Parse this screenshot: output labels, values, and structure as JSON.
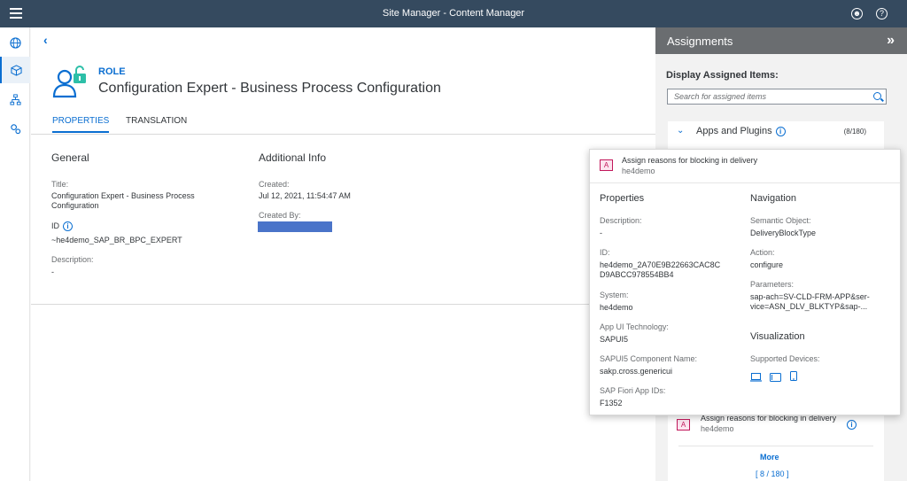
{
  "shell": {
    "title": "Site Manager - Content Manager"
  },
  "role": {
    "label": "ROLE",
    "title": "Configuration Expert - Business Process Configuration",
    "tabs": [
      "PROPERTIES",
      "TRANSLATION"
    ]
  },
  "general": {
    "heading": "General",
    "title_label": "Title:",
    "title_value": "Configuration Expert - Business Process Configuration",
    "id_label": "ID",
    "id_value": "~he4demo_SAP_BR_BPC_EXPERT",
    "description_label": "Description:",
    "description_value": "-"
  },
  "additional": {
    "heading": "Additional Info",
    "created_label": "Created:",
    "created_value": "Jul 12, 2021, 11:54:47 AM",
    "created_by_label": "Created By:"
  },
  "assignments": {
    "title": "Assignments",
    "display_label": "Display Assigned Items:",
    "search_placeholder": "Search for assigned items",
    "group_label": "Apps and Plugins",
    "group_count": "(8/180)",
    "item_title": "Assign reasons for blocking in delivery",
    "item_subtitle": "he4demo",
    "more": "More",
    "pager": "[ 8 / 180 ]"
  },
  "popover": {
    "title": "Assign reasons for blocking in delivery",
    "subtitle": "he4demo",
    "properties_heading": "Properties",
    "description_label": "Description:",
    "description_value": "-",
    "id_label": "ID:",
    "id_value": "he4demo_2A70E9B22663CAC8C\nD9ABCC978554BB4",
    "system_label": "System:",
    "system_value": "he4demo",
    "tech_label": "App UI Technology:",
    "tech_value": "SAPUI5",
    "component_label": "SAPUI5 Component Name:",
    "component_value": "sakp.cross.genericui",
    "fiori_label": "SAP Fiori App IDs:",
    "fiori_value": "F1352",
    "navigation_heading": "Navigation",
    "semantic_label": "Semantic Object:",
    "semantic_value": "DeliveryBlockType",
    "action_label": "Action:",
    "action_value": "configure",
    "parameters_label": "Parameters:",
    "parameters_value": "sap-ach=SV-CLD-FRM-APP&ser-\nvice=ASN_DLV_BLKTYP&sap-...",
    "visualization_heading": "Visualization",
    "devices_label": "Supported Devices:"
  },
  "colors": {
    "shell": "#354a5f",
    "accent": "#0a6ed1",
    "panel_header": "#6a6d70"
  },
  "icons": [
    "menu-icon",
    "user-icon",
    "help-icon",
    "globe-icon",
    "cube-icon",
    "sitemap-icon",
    "settings-icon",
    "role-icon",
    "info-icon",
    "search-icon",
    "app-tile-icon",
    "desktop-icon",
    "tablet-icon",
    "phone-icon"
  ]
}
